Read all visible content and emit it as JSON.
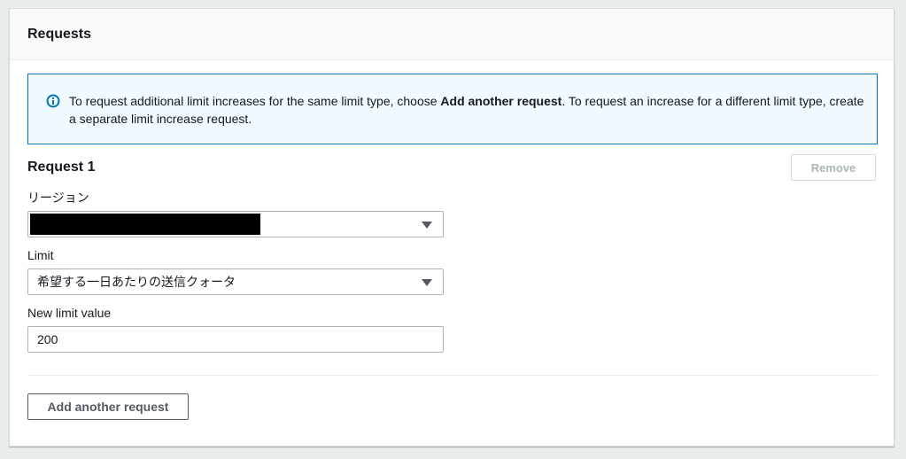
{
  "panel": {
    "title": "Requests"
  },
  "info": {
    "text_before": "To request additional limit increases for the same limit type, choose ",
    "text_bold": "Add another request",
    "text_after": ". To request an increase for a different limit type, create a separate limit increase request.",
    "icon": "info-icon"
  },
  "request": {
    "title": "Request 1",
    "remove_label": "Remove",
    "region_label": "リージョン",
    "region_value": "",
    "limit_label": "Limit",
    "limit_value": "希望する一日あたりの送信クォータ",
    "new_limit_label": "New limit value",
    "new_limit_value": "200"
  },
  "footer": {
    "add_label": "Add another request"
  },
  "colors": {
    "info_border": "#0073bb",
    "info_bg": "#f1faff",
    "text": "#16191f",
    "disabled": "#aab7b8"
  }
}
